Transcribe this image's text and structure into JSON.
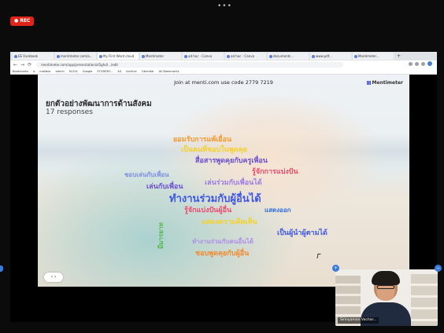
{
  "meeting": {
    "top_dots": "•••",
    "rec_label": "● REC"
  },
  "browser": {
    "tabs": [
      {
        "label": "EE Facebook",
        "active": false
      },
      {
        "label": "mentimeter.com/a...",
        "active": false
      },
      {
        "label": "My First Word cloud",
        "active": true
      },
      {
        "label": "Mentimeter",
        "active": false
      },
      {
        "label": "ad hoc - Canva",
        "active": false
      },
      {
        "label": "ad hoc - Canva",
        "active": false
      },
      {
        "label": "documents...",
        "active": false
      },
      {
        "label": "www.pdf...",
        "active": false
      },
      {
        "label": "Mentimeter...",
        "active": false
      }
    ],
    "url": "mentimeter.com/app/presentation/al5ghd/.../edit",
    "bookmarks": [
      "Bookmarks",
      "a",
      "mailbox",
      "admin",
      "DCI24",
      "Google",
      "STUDENT...",
      "A3",
      "Archive",
      "Calendar",
      "All Bookmarks"
    ]
  },
  "slide": {
    "join_text": "Join at menti.com use code 2779 7219",
    "brand": "Mentimeter",
    "title": "ยกตัวอย่างพัฒนาการด้านสังคม",
    "responses": "17 responses",
    "words": [
      {
        "text": "ยอมรับการแพ้เยื่อน",
        "color": "#f59a2e",
        "size": 9
      },
      {
        "text": "เป็นคนที่ชอบในพูดคุย",
        "color": "#f4d12a",
        "size": 9
      },
      {
        "text": "สื่อสารพูดคุยกับครูเพื่อน",
        "color": "#6b4fcf",
        "size": 9
      },
      {
        "text": "รู้จักการแบ่งปัน",
        "color": "#e94b6f",
        "size": 9
      },
      {
        "text": "ชอบเล่นกับเพื่อน",
        "color": "#7a8ee0",
        "size": 8
      },
      {
        "text": "เล่นกับเพื่อน",
        "color": "#6b4fcf",
        "size": 9
      },
      {
        "text": "เล่นร่วมกับเพื่อนได้",
        "color": "#9c7be4",
        "size": 9
      },
      {
        "text": "ทำงานร่วมกับผู้อื่นได้",
        "color": "#3d56e6",
        "size": 13
      },
      {
        "text": "รู้จักแบ่งปันผู้อื่น",
        "color": "#e94b6f",
        "size": 9
      },
      {
        "text": "แสดงความคิดเห็น",
        "color": "#f4d12a",
        "size": 9
      },
      {
        "text": "แสดงออก",
        "color": "#2f6fe0",
        "size": 8
      },
      {
        "text": "มีมารยาท",
        "color": "#4fb646",
        "size": 8
      },
      {
        "text": "เป็นผู้นำผู้ตามได้",
        "color": "#3d56e6",
        "size": 9
      },
      {
        "text": "ทำงานร่วมกับคนอื่นได้",
        "color": "#b08ee8",
        "size": 8
      },
      {
        "text": "ชอบพูดคุยกับผู้อื่น",
        "color": "#f08a2e",
        "size": 9
      }
    ],
    "controls": "‹  ›"
  },
  "video": {
    "name": "Sirinyaman Vachar..."
  },
  "colors": {
    "accent": "#3a7be0",
    "rec": "#e2231a"
  }
}
